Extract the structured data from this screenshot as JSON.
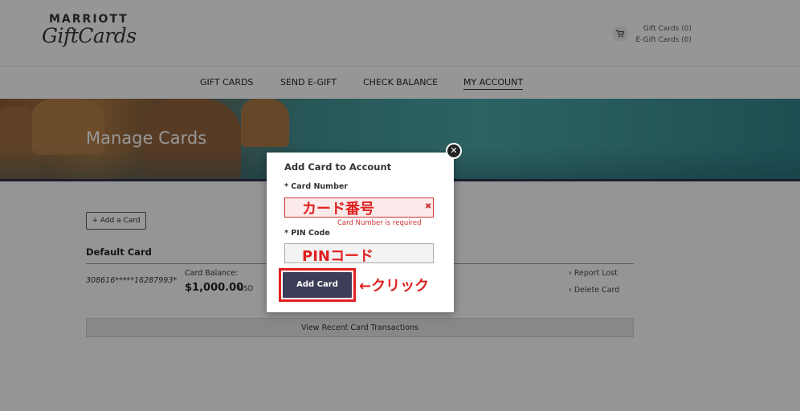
{
  "header": {
    "logo_top": "MARRIOTT",
    "logo_bottom": "GiftCards",
    "cart": {
      "gift_cards": "Gift Cards (0)",
      "egift_cards": "E-Gift Cards (0)"
    }
  },
  "nav": {
    "items": [
      {
        "label": "GIFT CARDS"
      },
      {
        "label": "SEND E-GIFT"
      },
      {
        "label": "CHECK BALANCE"
      },
      {
        "label": "MY ACCOUNT"
      }
    ]
  },
  "hero": {
    "title": "Manage Cards"
  },
  "content": {
    "add_card_button": "+ Add a Card",
    "default_card_title": "Default Card",
    "card_number": "308616*****16287993*",
    "balance_label": "Card Balance:",
    "balance_value": "$1,000.00",
    "balance_currency": "USD",
    "report_lost": "Report Lost",
    "delete_card": "Delete Card",
    "transactions": "View Recent Card Transactions"
  },
  "modal": {
    "title": "Add Card to Account",
    "card_number_label": "* Card Number",
    "card_number_annotation": "カード番号",
    "card_number_error": "Card Number is required",
    "pin_label": "* PIN Code",
    "pin_annotation": "PINコード",
    "submit_label": "Add Card",
    "click_annotation": "←クリック"
  },
  "colors": {
    "accent": "#3e3d57",
    "error": "#cc3333",
    "annotation": "#e02020"
  }
}
